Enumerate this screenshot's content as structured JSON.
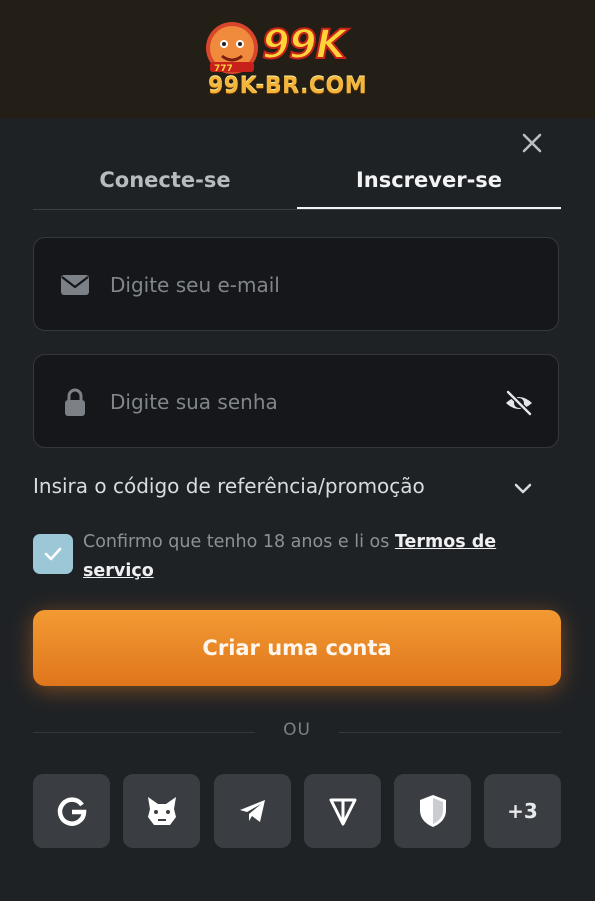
{
  "header": {
    "logo_brand": "99K",
    "logo_domain": "99K-BR.COM",
    "accent_gold": "#f4b63a",
    "accent_red": "#c8211b"
  },
  "modal": {
    "close_icon": "close-icon",
    "tabs": [
      {
        "label": "Conecte-se",
        "active": false
      },
      {
        "label": "Inscrever-se",
        "active": true
      }
    ],
    "email": {
      "placeholder": "Digite seu e-mail",
      "value": "",
      "icon": "mail-icon"
    },
    "password": {
      "placeholder": "Digite sua senha",
      "value": "",
      "icon": "lock-icon",
      "toggle_icon": "eye-off-icon"
    },
    "promo": {
      "label": "Insira o código de referência/promoção",
      "icon": "chevron-down-icon"
    },
    "terms": {
      "checked": true,
      "text": "Confirmo que tenho 18 anos e li os ",
      "link_label": "Termos de serviço"
    },
    "submit_label": "Criar uma conta",
    "divider_label": "OU",
    "socials": [
      {
        "name": "google-icon"
      },
      {
        "name": "metamask-icon"
      },
      {
        "name": "telegram-icon"
      },
      {
        "name": "ton-icon"
      },
      {
        "name": "shield-icon"
      },
      {
        "label": "+3"
      }
    ],
    "colors": {
      "background": "#1f2225",
      "cta": "#ec8a28",
      "checkbox": "#9cc7d6"
    }
  }
}
